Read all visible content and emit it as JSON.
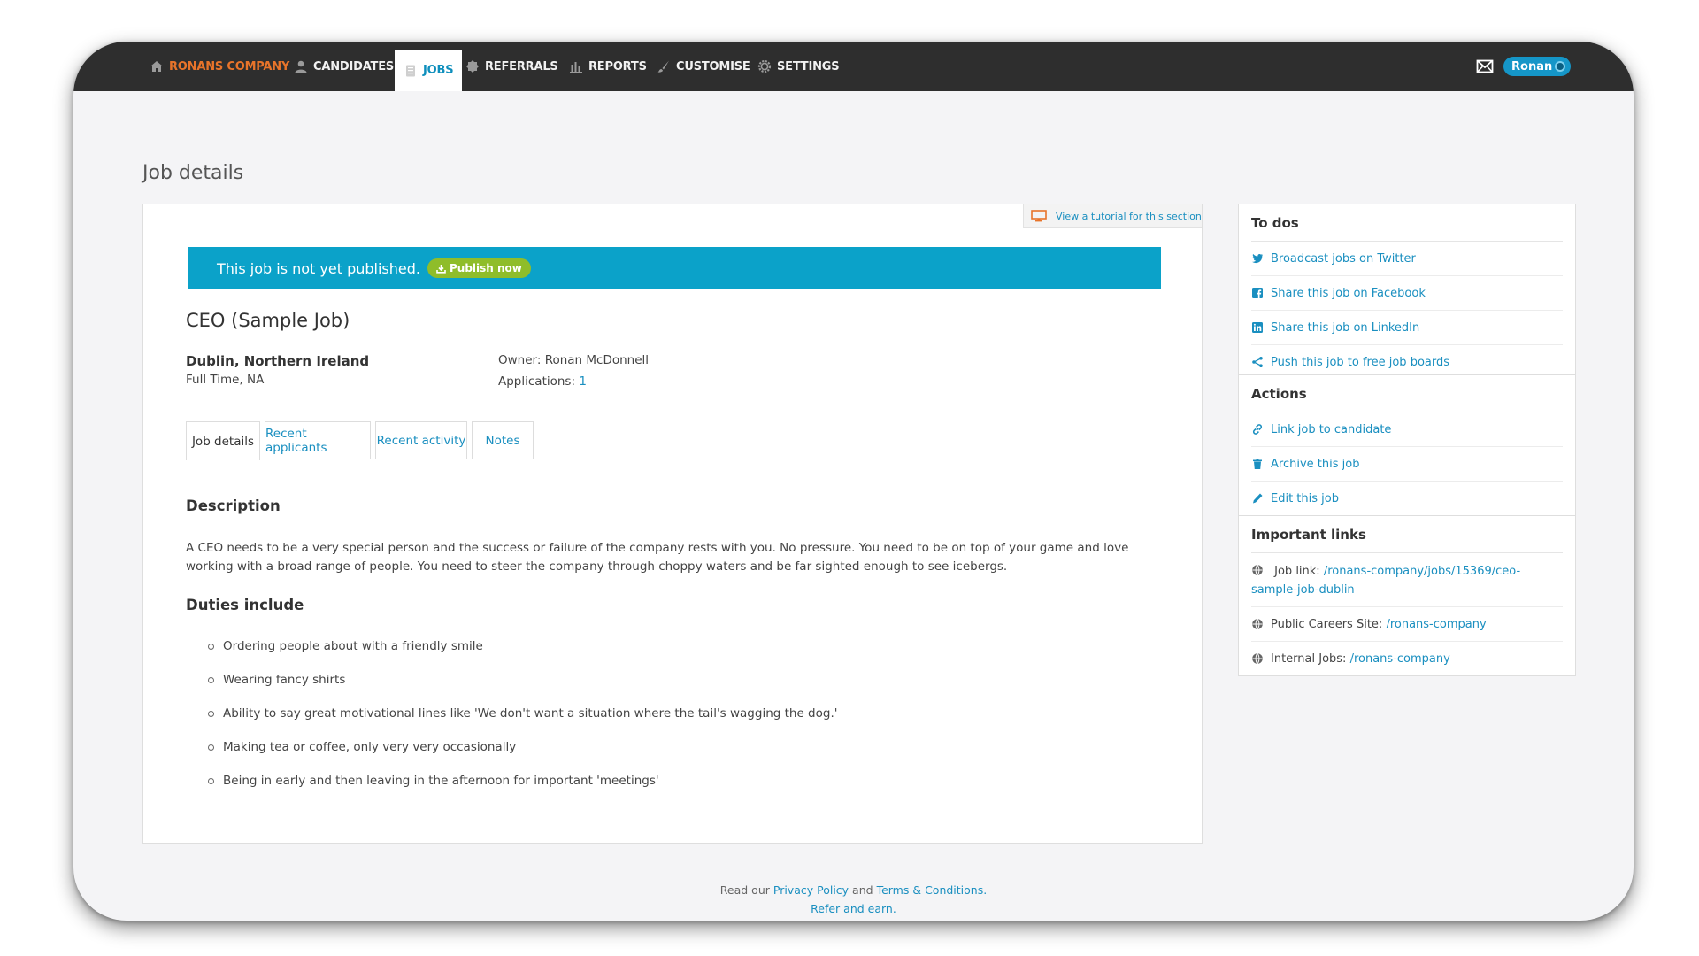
{
  "nav": {
    "brand": "RONANS COMPANY",
    "items": [
      {
        "label": "CANDIDATES"
      },
      {
        "label": "JOBS"
      },
      {
        "label": "REFERRALS"
      },
      {
        "label": "REPORTS"
      },
      {
        "label": "CUSTOMISE"
      },
      {
        "label": "SETTINGS"
      }
    ],
    "user": "Ronan"
  },
  "page": {
    "title": "Job details"
  },
  "tutorial_link": "View a tutorial for this section",
  "publish": {
    "message": "This job is not yet published.",
    "button": "Publish now"
  },
  "job": {
    "title": "CEO (Sample Job)",
    "location": "Dublin, Northern Ireland",
    "type": "Full Time, NA",
    "owner_label": "Owner:",
    "owner": "Ronan McDonnell",
    "applications_label": "Applications:",
    "applications": "1"
  },
  "tabs": [
    {
      "label": "Job details"
    },
    {
      "label": "Recent applicants"
    },
    {
      "label": "Recent activity"
    },
    {
      "label": "Notes"
    }
  ],
  "description": {
    "heading": "Description",
    "text": "A CEO needs to be a very special person and the success or failure of the company rests with you. No pressure. You need to be on top of your game and love working with a broad range of people. You need to steer the company through choppy waters and be far sighted enough to see icebergs."
  },
  "duties": {
    "heading": "Duties include",
    "items": [
      "Ordering people about with a friendly smile",
      "Wearing fancy shirts",
      "Ability to say great motivational lines like 'We don't want a situation where the tail's wagging the dog.'",
      "Making tea or coffee, only very very occasionally",
      "Being in early and then leaving in the afternoon for important 'meetings'"
    ]
  },
  "todos": {
    "title": "To dos",
    "items": [
      "Broadcast jobs on Twitter",
      "Share this job on Facebook",
      "Share this job on LinkedIn",
      "Push this job to free job boards"
    ]
  },
  "actions": {
    "title": "Actions",
    "items": [
      "Link job to candidate",
      "Archive this job",
      "Edit this job"
    ]
  },
  "links": {
    "title": "Important links",
    "job_link_label": "Job link:",
    "job_link": "/ronans-company/jobs/15369/ceo-sample-job-dublin",
    "careers_label": "Public Careers Site:",
    "careers": "/ronans-company",
    "internal_label": "Internal Jobs:",
    "internal": "/ronans-company"
  },
  "footer": {
    "prefix": "Read our",
    "privacy": "Privacy Policy",
    "and": "and",
    "terms": "Terms & Conditions.",
    "refer": "Refer and earn."
  },
  "colors": {
    "accent": "#1a8fc0",
    "brand": "#e8742a",
    "publish_bar": "#0ba2c9",
    "publish_button": "#8fbd2a",
    "nav_bg": "#2e2e2e"
  }
}
